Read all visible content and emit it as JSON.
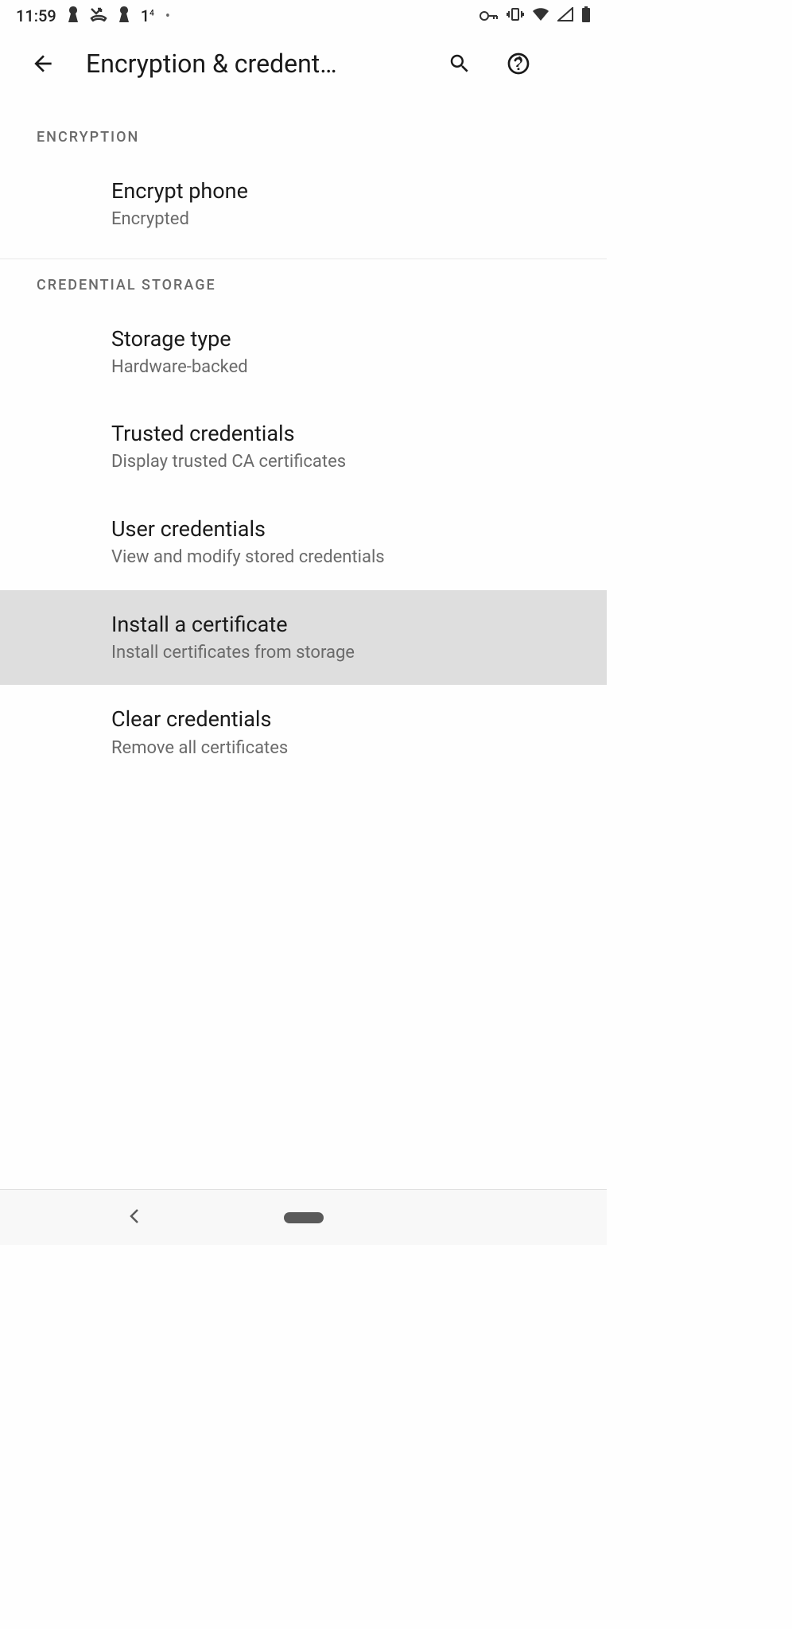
{
  "status": {
    "time": "11:59"
  },
  "header": {
    "title": "Encryption & credent…"
  },
  "sections": [
    {
      "header": "ENCRYPTION",
      "items": [
        {
          "title": "Encrypt phone",
          "subtitle": "Encrypted",
          "highlighted": false
        }
      ]
    },
    {
      "header": "CREDENTIAL STORAGE",
      "items": [
        {
          "title": "Storage type",
          "subtitle": "Hardware-backed",
          "highlighted": false
        },
        {
          "title": "Trusted credentials",
          "subtitle": "Display trusted CA certificates",
          "highlighted": false
        },
        {
          "title": "User credentials",
          "subtitle": "View and modify stored credentials",
          "highlighted": false
        },
        {
          "title": "Install a certificate",
          "subtitle": "Install certificates from storage",
          "highlighted": true
        },
        {
          "title": "Clear credentials",
          "subtitle": "Remove all certificates",
          "highlighted": false
        }
      ]
    }
  ]
}
